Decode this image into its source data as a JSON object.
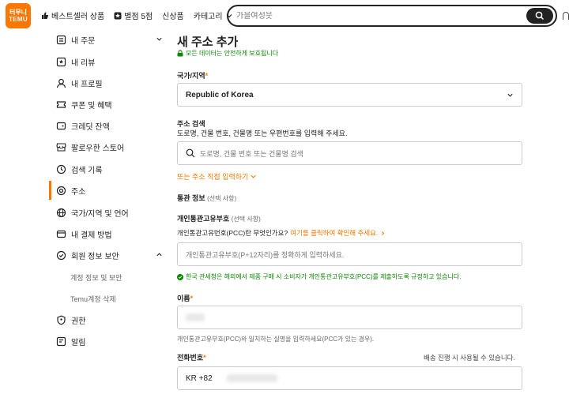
{
  "header": {
    "logo_top": "터무니",
    "logo_bottom": "TEMU",
    "nav": [
      {
        "label": "베스트셀러 상품",
        "icon": "thumbs-up-icon"
      },
      {
        "label": "별점 5점",
        "icon": "star-badge-icon"
      },
      {
        "label": "신상품",
        "icon": ""
      },
      {
        "label": "카테고리",
        "icon": "chevron-down-icon"
      }
    ],
    "search_placeholder": "가을여성웃"
  },
  "sidebar": {
    "items": [
      {
        "label": "내 주문",
        "icon": "orders-icon"
      },
      {
        "label": "내 리뷰",
        "icon": "review-icon"
      },
      {
        "label": "내 프로필",
        "icon": "profile-icon"
      },
      {
        "label": "쿠폰 및 혜택",
        "icon": "coupon-icon"
      },
      {
        "label": "크레딧 잔액",
        "icon": "credit-icon"
      },
      {
        "label": "팔로우한 스토어",
        "icon": "store-icon"
      },
      {
        "label": "검색 기록",
        "icon": "history-icon"
      },
      {
        "label": "주소",
        "icon": "location-icon"
      },
      {
        "label": "국가/지역 및 언어",
        "icon": "globe-icon"
      },
      {
        "label": "내 결제 방법",
        "icon": "card-icon"
      },
      {
        "label": "회원 정보 보안",
        "icon": "shield-icon"
      },
      {
        "label": "계정 정보 및 보안",
        "icon": ""
      },
      {
        "label": "Temu계정 삭제",
        "icon": ""
      },
      {
        "label": "권한",
        "icon": "permission-icon"
      },
      {
        "label": "알림",
        "icon": "notification-icon"
      }
    ]
  },
  "main": {
    "title": "새 주소 추가",
    "secure_note": "모든 데이터는 안전하게 보호됩니다",
    "country_label": "국가/지역",
    "country_value": "Republic of Korea",
    "address_search_label": "주소 검색",
    "address_search_hint": "도로명, 건물 번호, 건물명 또는 우편번호를 입력해 주세요.",
    "address_search_placeholder": "도로명, 건물 번호 또는 건물명 검색",
    "manual_entry_link": "또는 주소 직접 입력하기",
    "customs_label": "통관 정보",
    "optional": "(선택 사항)",
    "pccc_label": "개인통관고유부호",
    "pccc_question": "개인통관고유번호(PCC)란 무엇인가요?",
    "pccc_link": "여기를 클릭하여 확인해 주세요.",
    "pccc_placeholder": "개인통관고유부호(P+12자리)를 정확하게 입력하세요.",
    "pccc_notice": "한국 관세청은 해외에서 제품 구매 시 소비자가 개인통관고유부호(PCC)를 제출하도록 규정하고 있습니다.",
    "name_label": "이름",
    "name_hint": "개인통관고유부호(PCC)와 일치하는 실명을 입력하세요(PCC가 있는 경우).",
    "phone_label": "전화번호",
    "phone_note": "배송 진행 시 사용될 수 있습니다.",
    "phone_prefix": "KR +82"
  },
  "colors": {
    "accent": "#fb7701",
    "secure": "#0a8800"
  }
}
